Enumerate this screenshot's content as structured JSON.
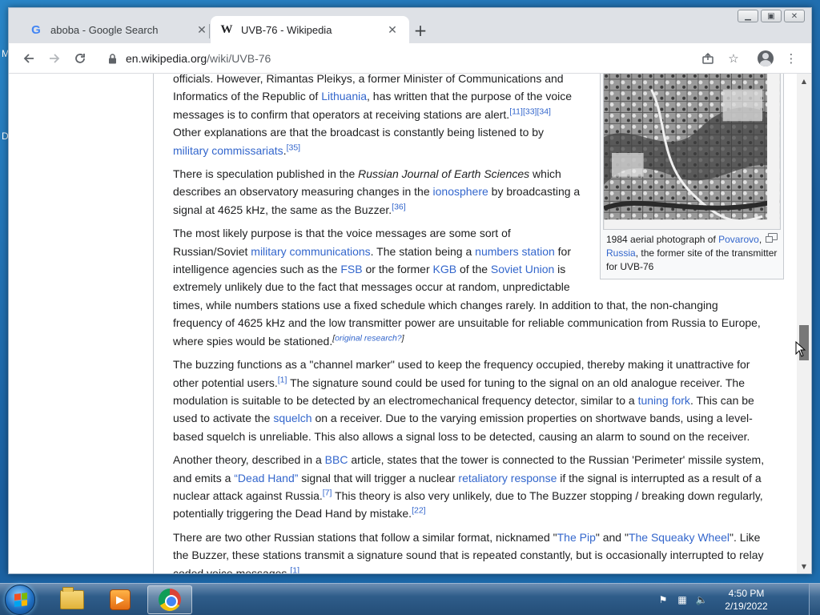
{
  "desktop": {
    "left_glyph_1": "M",
    "left_glyph_2": "D"
  },
  "browser": {
    "tabs": [
      {
        "title": "aboba - Google Search",
        "favicon": "google-g-icon",
        "active": false
      },
      {
        "title": "UVB-76 - Wikipedia",
        "favicon": "wikipedia-w-icon",
        "active": true
      }
    ],
    "favicon_glyphs": {
      "google": "G",
      "wikipedia": "W"
    },
    "new_tab_glyph": "+",
    "url_domain": "en.wikipedia.org",
    "url_path": "/wiki/UVB-76"
  },
  "article": {
    "infobox": {
      "caption_before": "1984 aerial photograph of ",
      "caption_link_1": "Povarovo",
      "caption_sep": ", ",
      "caption_link_2": "Russia",
      "caption_after": ", the former site of the transmitter for UVB-76"
    },
    "p1": {
      "t1": "officials. However, Rimantas Pleikys, a former Minister of Communications and Informatics of the Republic of ",
      "l1": "Lithuania",
      "t2": ", has written that the purpose of the voice messages is to confirm that operators at receiving stations are alert.",
      "s1": "[11]",
      "s2": "[33]",
      "s3": "[34]",
      "t3": " Other explanations are that the broadcast is constantly being listened to by ",
      "l2": "military commissariats",
      "t4": ".",
      "s4": "[35]"
    },
    "p2": {
      "t1": "There is speculation published in the ",
      "i1": "Russian Journal of Earth Sciences",
      "t2": " which describes an observatory measuring changes in the ",
      "l1": "ionosphere",
      "t3": " by broadcasting a signal at 4625 kHz, the same as the Buzzer.",
      "s1": "[36]"
    },
    "p3": {
      "t1": "The most likely purpose is that the voice messages are some sort of Russian/Soviet ",
      "l1": "military communications",
      "t2": ". The station being a ",
      "l2": "numbers station",
      "t3": " for intelligence agencies such as the ",
      "l3": "FSB",
      "t4": " or the former ",
      "l4": "KGB",
      "t5": " of the ",
      "l5": "Soviet Union",
      "t6": " is extremely unlikely due to the fact that messages occur at random, unpredictable times, while numbers stations use a fixed schedule which changes rarely. In addition to that, the non-changing frequency of 4625 kHz and the low transmitter power are unsuitable for reliable communication from Russia to Europe, where spies would be stationed.",
      "s1_open": "[",
      "s1_link": "original research?",
      "s1_close": "]"
    },
    "p4": {
      "t1": "The buzzing functions as a \"channel marker\" used to keep the frequency occupied, thereby making it unattractive for other potential users.",
      "s1": "[1]",
      "t2": " The signature sound could be used for tuning to the signal on an old analogue receiver. The modulation is suitable to be detected by an electromechanical frequency detector, similar to a ",
      "l1": "tuning fork",
      "t3": ". This can be used to activate the ",
      "l2": "squelch",
      "t4": " on a receiver. Due to the varying emission properties on shortwave bands, using a level-based squelch is unreliable. This also allows a signal loss to be detected, causing an alarm to sound on the receiver."
    },
    "p5": {
      "t1": "Another theory, described in a ",
      "l1": "BBC",
      "t2": " article, states that the tower is connected to the Russian 'Perimeter' missile system, and emits a ",
      "l2": "“Dead Hand”",
      "t3": " signal that will trigger a nuclear ",
      "l3": "retaliatory response",
      "t4": " if the signal is interrupted as a result of a nuclear attack against Russia.",
      "s1": "[7]",
      "t5": " This theory is also very unlikely, due to The Buzzer stopping / breaking down regularly, potentially triggering the Dead Hand by mistake.",
      "s2": "[22]"
    },
    "p6": {
      "t1": "There are two other Russian stations that follow a similar format, nicknamed \"",
      "l1": "The Pip",
      "t2": "\" and \"",
      "l2": "The Squeaky Wheel",
      "t3": "\". Like the Buzzer, these stations transmit a signature sound that is repeated constantly, but is occasionally interrupted to relay coded voice messages.",
      "s1": "[1]"
    }
  },
  "taskbar": {
    "items": [
      "windows-explorer-icon",
      "media-player-icon",
      "chrome-icon"
    ],
    "clock_time": "4:50 PM",
    "clock_date": "2/19/2022"
  }
}
